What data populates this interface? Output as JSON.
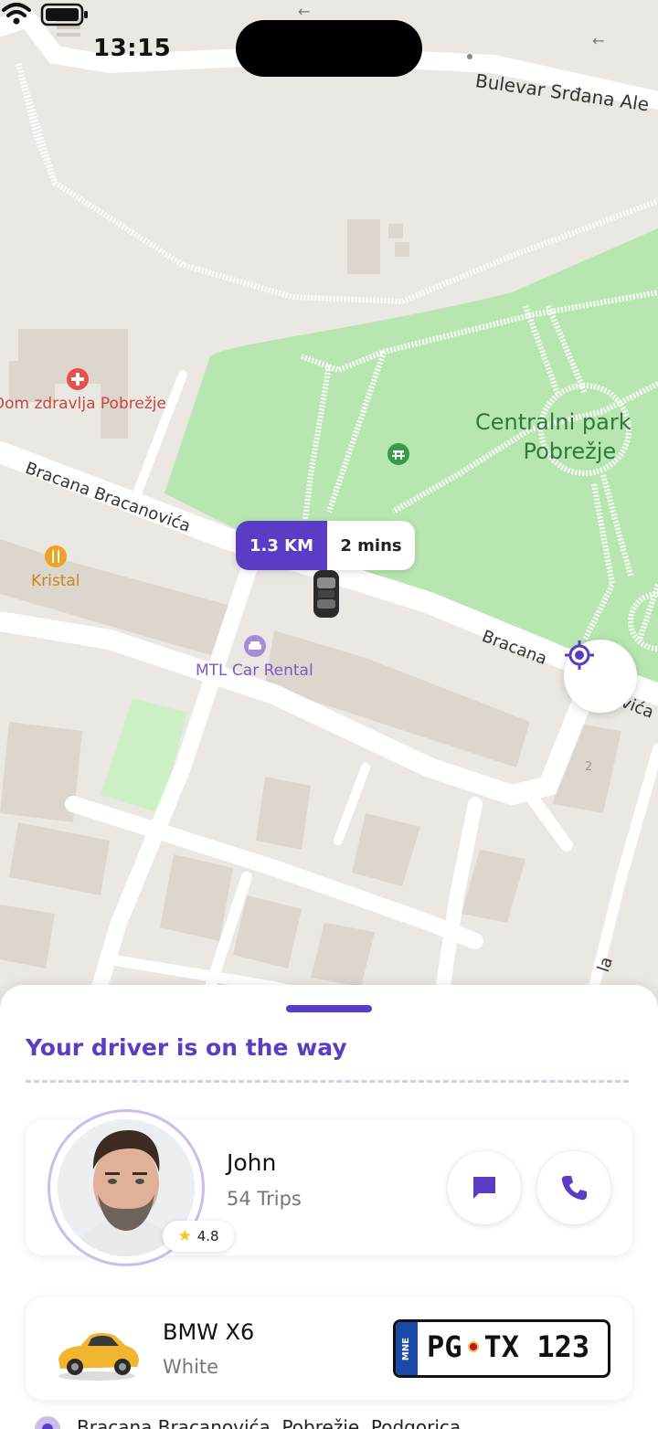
{
  "status_bar": {
    "time": "13:15"
  },
  "map": {
    "streets": {
      "top": "Bulevar Srđana Ale",
      "middle": "Bracana Bracanovića",
      "right_a": "Bracana",
      "right_b": "vića",
      "bottom_right": "la"
    },
    "park_label_line1": "Centralni park",
    "park_label_line2": "Pobrežje",
    "poi": {
      "clinic": "Dom zdravlja Pobrežje",
      "restaurant": "Kristal",
      "rental": "MTL Car Rental",
      "house_number": "2"
    },
    "eta": {
      "distance": "1.3 KM",
      "time": "2 mins"
    },
    "colors": {
      "land": "#ebe7e3",
      "park": "#b8e6b0",
      "road": "#ffffff",
      "building": "#ddd6cf"
    }
  },
  "sheet": {
    "title": "Your driver is on the way",
    "accent": "#5b3cc4",
    "driver": {
      "name": "John",
      "trips": "54 Trips",
      "rating": "4.8",
      "rating_icon": "star-icon",
      "message_icon": "message-icon",
      "call_icon": "phone-icon"
    },
    "car": {
      "model": "BMW X6",
      "color": "White",
      "plate_country": "MNE",
      "plate_left": "PG",
      "plate_right": "TX 123"
    },
    "next_stop": "Bracana Bracanovića, Pobrežje, Podgorica"
  }
}
